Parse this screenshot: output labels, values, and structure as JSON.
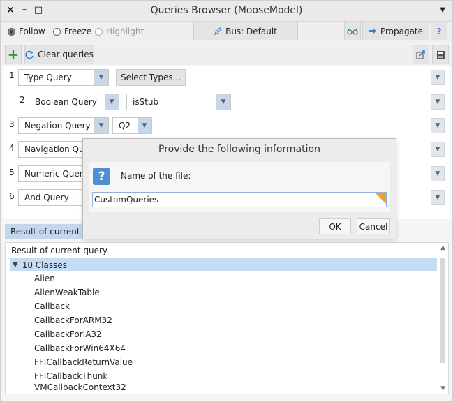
{
  "window": {
    "title": "Queries Browser (MooseModel)",
    "close_glyph": "×",
    "minimize_glyph": "–",
    "maximize_glyph": "□",
    "menu_glyph": "▼"
  },
  "toolbar": {
    "radios": [
      {
        "label": "Follow",
        "selected": true,
        "enabled": true
      },
      {
        "label": "Freeze",
        "selected": false,
        "enabled": true
      },
      {
        "label": "Highlight",
        "selected": false,
        "enabled": false
      }
    ],
    "bus_label": "Bus: Default",
    "propagate_label": "Propagate",
    "help_label": "?",
    "clear_label": "Clear queries",
    "add_glyph": "+"
  },
  "queries": [
    {
      "num": "1",
      "type": "Type Query",
      "extra_button": "Select Types..."
    },
    {
      "num": "2",
      "type": "Boolean Query",
      "param": "isStub"
    },
    {
      "num": "3",
      "type": "Negation Query",
      "param": "Q2"
    },
    {
      "num": "4",
      "type": "Navigation Query"
    },
    {
      "num": "5",
      "type": "Numeric Query"
    },
    {
      "num": "6",
      "type": "And Query"
    }
  ],
  "results": {
    "tab_label": "Result of current query",
    "header": "Result of current query",
    "root_label": "10 Classes",
    "items": [
      "Alien",
      "AlienWeakTable",
      "Callback",
      "CallbackForARM32",
      "CallbackForIA32",
      "CallbackForWin64X64",
      "FFICallbackReturnValue",
      "FFICallbackThunk",
      "VMCallbackContext32"
    ]
  },
  "dialog": {
    "title": "Provide the following information",
    "icon": "?",
    "label": "Name of the file:",
    "value": "CustomQueries",
    "ok_label": "OK",
    "cancel_label": "Cancel"
  },
  "colors": {
    "accent": "#c6dbf4",
    "dropdown_arrow": "#4a6b92",
    "help_icon": "#4d8fd0",
    "add_icon": "#2e9e3e"
  },
  "icons": [
    "close-icon",
    "minimize-icon",
    "maximize-icon",
    "window-menu-icon",
    "pencil-icon",
    "glasses-icon",
    "arrow-right-icon",
    "help-icon",
    "add-icon",
    "refresh-icon",
    "export-icon",
    "save-icon",
    "dropdown-arrow-icon",
    "question-icon"
  ]
}
